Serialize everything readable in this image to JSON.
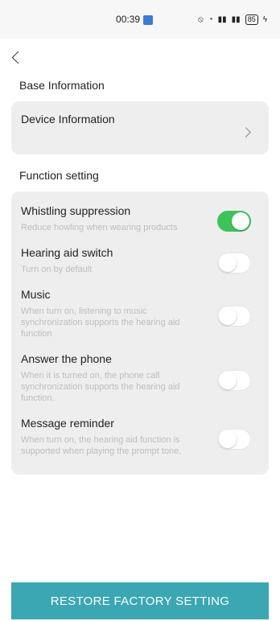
{
  "status_bar": {
    "time": "00:39",
    "battery": "85"
  },
  "sections": {
    "base_title": "Base Information",
    "function_title": "Function setting"
  },
  "device": {
    "label": "Device Information"
  },
  "settings": [
    {
      "title": "Whistling suppression",
      "desc": "Reduce howling when wearing products",
      "on": true
    },
    {
      "title": "Hearing aid switch",
      "desc": "Turn on by default",
      "on": false
    },
    {
      "title": "Music",
      "desc": "When turn on, listening to music synchronization supports the hearing aid function",
      "on": false
    },
    {
      "title": "Answer the phone",
      "desc": "When it is turned on, the phone call synchronization supports the hearing aid function.",
      "on": false
    },
    {
      "title": "Message reminder",
      "desc": "When turn on, the hearing aid function is supported when playing the prompt tone.",
      "on": false
    }
  ],
  "restore_button": {
    "label": "RESTORE FACTORY SETTING"
  },
  "colors": {
    "toggle_on": "#3dc35a",
    "button": "#3aa7b3",
    "card": "#eeeeee"
  }
}
